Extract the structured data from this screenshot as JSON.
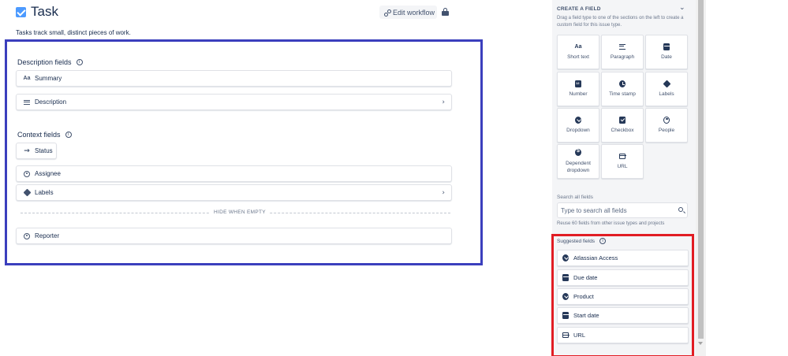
{
  "header": {
    "title": "Task",
    "edit_workflow": "Edit workflow",
    "subtitle": "Tasks track small, distinct pieces of work."
  },
  "description_section": {
    "title": "Description fields",
    "fields": [
      {
        "label": "Summary",
        "icon": "short-text-icon"
      },
      {
        "label": "Description",
        "icon": "paragraph-icon"
      }
    ]
  },
  "context_section": {
    "title": "Context fields",
    "fields": [
      {
        "label": "Status",
        "icon": "arrow-right-icon"
      },
      {
        "label": "Assignee",
        "icon": "person-icon"
      },
      {
        "label": "Labels",
        "icon": "label-icon"
      }
    ],
    "hide_when_empty": "HIDE WHEN EMPTY",
    "hidden_fields": [
      {
        "label": "Reporter",
        "icon": "person-icon"
      }
    ]
  },
  "create_field": {
    "title": "CREATE A FIELD",
    "description": "Drag a field type to one of the sections on the left to create a custom field for this issue type.",
    "types": [
      {
        "label": "Short text",
        "icon": "short-text-icon"
      },
      {
        "label": "Paragraph",
        "icon": "paragraph-icon"
      },
      {
        "label": "Date",
        "icon": "calendar-icon"
      },
      {
        "label": "Number",
        "icon": "number-icon"
      },
      {
        "label": "Time stamp",
        "icon": "clock-icon"
      },
      {
        "label": "Labels",
        "icon": "label-icon"
      },
      {
        "label": "Dropdown",
        "icon": "dropdown-icon"
      },
      {
        "label": "Checkbox",
        "icon": "checkbox-icon"
      },
      {
        "label": "People",
        "icon": "person-icon"
      },
      {
        "label": "Dependent dropdown",
        "icon": "dependent-dropdown-icon"
      },
      {
        "label": "URL",
        "icon": "url-icon"
      }
    ]
  },
  "search": {
    "label": "Search all fields",
    "placeholder": "Type to search all fields",
    "hint": "Reuse 60 fields from other issue types and projects"
  },
  "suggested": {
    "title": "Suggested fields",
    "items": [
      {
        "label": "Atlassian Access",
        "icon": "dropdown-icon"
      },
      {
        "label": "Due date",
        "icon": "calendar-icon"
      },
      {
        "label": "Product",
        "icon": "dropdown-icon"
      },
      {
        "label": "Start date",
        "icon": "calendar-icon"
      },
      {
        "label": "URL",
        "icon": "url-icon"
      }
    ]
  },
  "colors": {
    "main_highlight": "#3b3fbd",
    "suggested_highlight": "#e11d24",
    "checkbox_blue": "#4c9aff",
    "sidebar_bg": "#f4f5f7"
  }
}
